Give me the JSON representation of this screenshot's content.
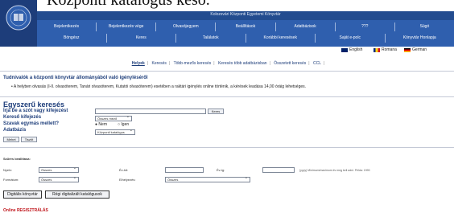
{
  "header": {
    "big_title": "Központi katalógus keső.",
    "logo_text": "CENTRAL UNIVERSITY LIBRARY",
    "top_title": "Kolozsvári Központi Egyetemi Könyvtár"
  },
  "menu": {
    "row1": [
      "Bejelentkezés",
      "Bejelentkezés vége",
      "Olvasójegyem",
      "Beállítások",
      "Adatbázisok",
      "???",
      "Súgó"
    ],
    "row2": [
      "Böngész",
      "Keres",
      "Találatok",
      "Korábbi keresések",
      "Saját e-polc",
      "Könyvtár Honlapja"
    ]
  },
  "languages": [
    "English",
    "Romana",
    "German"
  ],
  "subnav": [
    "Helyek",
    "Keresés",
    "Több-mezős keresés",
    "Keresés több adatbázisban",
    "Összetett keresés",
    "CCL"
  ],
  "notice": {
    "title": "Tudnivalók a központi könyvtár állományából való igényléséről",
    "text": "A helyben olvasás (I-II. olvasóterem, Tanári olvasóterem, Kutatói olvasóterem) esetében a raktári igénylés online történik, a kérések leadása 14,00 óráig lehetséges."
  },
  "simple_search": {
    "heading": "Egyszerű keresés",
    "query_label": "Írja be a szót vagy kifejezést",
    "query_value": "",
    "search_button": "Keres",
    "field_label": "Kereső kifejezés",
    "field_value": "Összes mező",
    "adjacent_label": "Szavak egymás mellett?",
    "adjacent_no": "Nem",
    "adjacent_yes": "Igen",
    "database_label": "Adatbázis",
    "database_value": "Központi katalógus",
    "submit": "Mehet",
    "reset": "Tisztít"
  },
  "filters": {
    "title": "Szűrés beállítása:",
    "language_label": "Nyelv:",
    "language_value": "Összes",
    "year_from_label": "Év-tól:",
    "year_to_label": "Év-ig:",
    "year_note": "(yyyy) Minimum/maximum év meg kell adni. Példa: 1990",
    "format_label": "Formátum:",
    "format_value": "Összes",
    "location_label": "Elhelyezés:",
    "location_value": "Összes"
  },
  "buttons": {
    "digital": "Digitális könyvtár",
    "old_catalog": "Régi digitalizált katalógusok"
  },
  "registration": "Online REGISZTRÁLÁS"
}
